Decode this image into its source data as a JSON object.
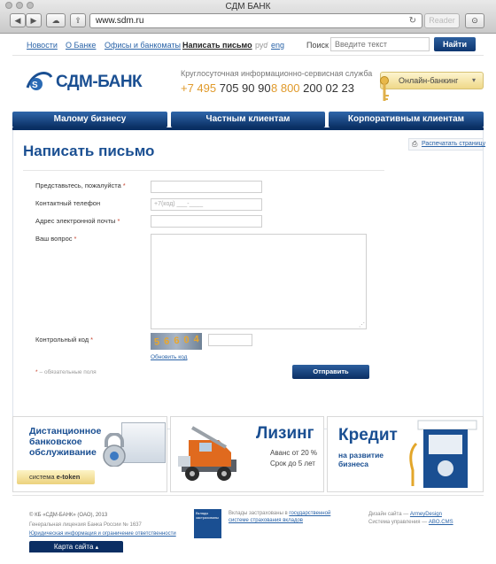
{
  "browser": {
    "title": "СДМ БАНК",
    "url": "www.sdm.ru",
    "reader": "Reader"
  },
  "topnav": {
    "links": [
      "Новости",
      "О Банке",
      "Офисы и банкоматы"
    ],
    "active": "Написать письмо",
    "lang_ru": "рус",
    "lang_sep": "/",
    "lang_en": "eng",
    "search_label": "Поиск",
    "search_placeholder": "Введите текст",
    "search_button": "Найти"
  },
  "header": {
    "logo_text": "СДМ-БАНК",
    "service": "Круглосуточная информационно-сервисная служба",
    "phone1_code": "+7 495",
    "phone1_number": "705 90 90",
    "phone2_code": "8 800",
    "phone2_number": "200 02 23",
    "online_banking": "Онлайн-банкинг"
  },
  "mainnav": [
    "Малому бизнесу",
    "Частным клиентам",
    "Корпоративным клиентам"
  ],
  "page": {
    "title": "Написать письмо",
    "print": "Распечатать страницу"
  },
  "form": {
    "name_label": "Представьтесь, пожалуйста",
    "phone_label": "Контактный телефон",
    "phone_placeholder": "+7(код) ___-____",
    "email_label": "Адрес электронной почты",
    "question_label": "Ваш вопрос",
    "captcha_label": "Контрольный код",
    "captcha_text": "5 6 6 0 4",
    "refresh_code": "Обновить код",
    "required_note": "– обязательные поля",
    "required_mark": "*",
    "submit": "Отправить"
  },
  "banners": {
    "b1_title": "Дистанционное банковское обслуживание",
    "b1_tag_prefix": "система",
    "b1_tag_strong": "e-token",
    "b2_title": "Лизинг",
    "b2_line1": "Аванс от 20 %",
    "b2_line2": "Срок до 5 лет",
    "b3_title": "Кредит",
    "b3_sub": "на развитие бизнеса"
  },
  "footer": {
    "copyright": "© КБ «СДМ-БАНК» (ОАО), 2013",
    "license": "Генеральная лицензия Банка России № 1637",
    "legal_link": "Юридическая информация и ограничение ответственности",
    "deposit_text1": "Вклады застрахованы в",
    "deposit_link": "государственной системе страхования вкладов",
    "deposit_logo": "Вклады застрахованы",
    "design_label": "Дизайн сайта —",
    "design_link": "ArmeyDesign",
    "cms_label": "Система управления —",
    "cms_link": "ABO.CMS",
    "sitemap": "Карта сайта"
  },
  "colors": {
    "brand_blue": "#1a4f92",
    "nav_dark": "#0a2f63",
    "phone_accent": "#e09a2b"
  }
}
